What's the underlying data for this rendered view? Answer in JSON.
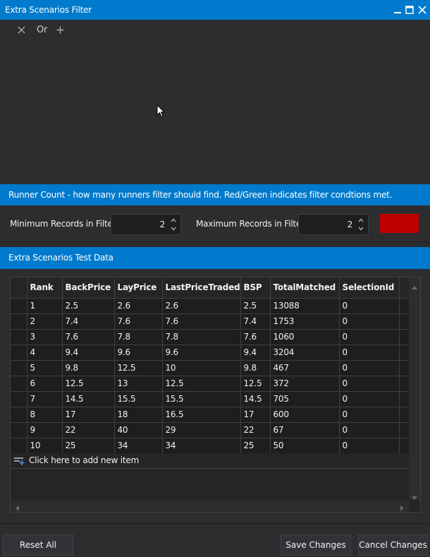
{
  "window": {
    "title": "Extra Scenarios Filter",
    "controls": {
      "minimize": "minimize",
      "maximize": "maximize",
      "close": "close"
    }
  },
  "filter_toolbar": {
    "remove_icon": "close-icon",
    "operator_label": "Or",
    "add_icon": "plus-icon"
  },
  "runner_info": {
    "text": "Runner Count - how many runners filter should find. Red/Green indicates filter condtions met."
  },
  "runner_count": {
    "min_label": "Minimum Records in Filter:",
    "min_value": "2",
    "max_label": "Maximum Records in Filter:",
    "max_value": "2",
    "indicator_color": "#c00000"
  },
  "test_data": {
    "title": "Extra Scenarios Test Data",
    "columns": [
      "Rank",
      "BackPrice",
      "LayPrice",
      "LastPriceTraded",
      "BSP",
      "TotalMatched",
      "SelectionId"
    ],
    "rows": [
      [
        "1",
        "2.5",
        "2.6",
        "2.6",
        "2.5",
        "13088",
        "0"
      ],
      [
        "2",
        "7.4",
        "7.6",
        "7.6",
        "7.4",
        "1753",
        "0"
      ],
      [
        "3",
        "7.6",
        "7.8",
        "7.8",
        "7.6",
        "1060",
        "0"
      ],
      [
        "4",
        "9.4",
        "9.6",
        "9.6",
        "9.4",
        "3204",
        "0"
      ],
      [
        "5",
        "9.8",
        "12.5",
        "10",
        "9.8",
        "467",
        "0"
      ],
      [
        "6",
        "12.5",
        "13",
        "12.5",
        "12.5",
        "372",
        "0"
      ],
      [
        "7",
        "14.5",
        "15.5",
        "15.5",
        "14.5",
        "705",
        "0"
      ],
      [
        "8",
        "17",
        "18",
        "16.5",
        "17",
        "600",
        "0"
      ],
      [
        "9",
        "22",
        "40",
        "29",
        "22",
        "67",
        "0"
      ],
      [
        "10",
        "25",
        "34",
        "34",
        "25",
        "50",
        "0"
      ]
    ],
    "add_new_label": "Click here to add new item"
  },
  "footer": {
    "reset_label": "Reset All",
    "save_label": "Save Changes",
    "cancel_label": "Cancel Changes"
  },
  "colors": {
    "accent": "#007acc",
    "background": "#2d2d30",
    "grid_background": "#1e1e1e",
    "indicator": "#c00000"
  }
}
